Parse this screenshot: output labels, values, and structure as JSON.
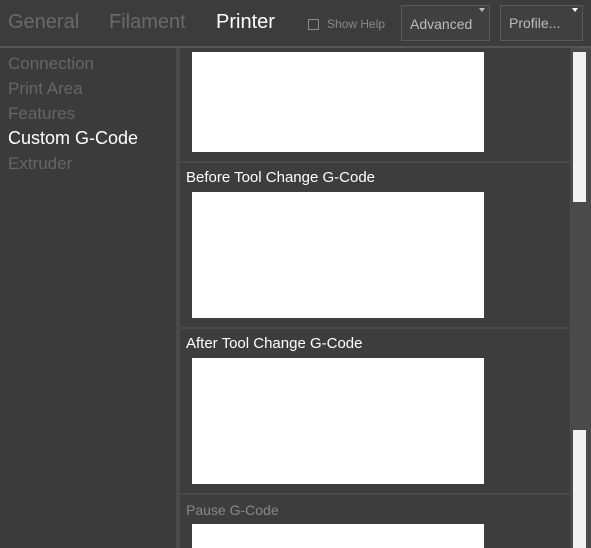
{
  "tabs": {
    "general": "General",
    "filament": "Filament",
    "printer": "Printer"
  },
  "show_help_label": "Show Help",
  "advanced_label": "Advanced",
  "profile_label": "Profile...",
  "sidebar": {
    "items": [
      {
        "label": "Connection"
      },
      {
        "label": "Print Area"
      },
      {
        "label": "Features"
      },
      {
        "label": "Custom G-Code"
      },
      {
        "label": "Extruder"
      }
    ]
  },
  "sections": [
    {
      "label": "Before Tool Change G-Code",
      "value": ""
    },
    {
      "label": "After Tool Change G-Code",
      "value": ""
    },
    {
      "label": "Pause G-Code",
      "value": ""
    }
  ],
  "colors": {
    "background": "#3a3a3a",
    "inactive_text": "#6a6a6a",
    "active_text": "#ffffff",
    "textarea": "#ffffff"
  }
}
